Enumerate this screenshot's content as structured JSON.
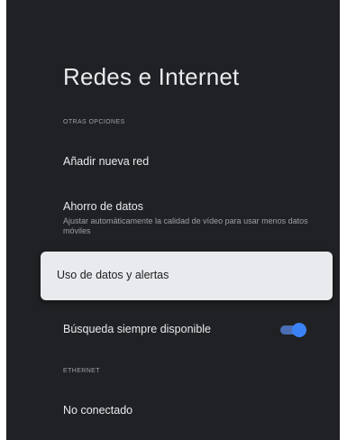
{
  "page": {
    "title": "Redes e Internet"
  },
  "sections": {
    "other_options": "OTRAS OPCIONES",
    "ethernet": "ETHERNET"
  },
  "items": {
    "add_network": {
      "label": "Añadir nueva red"
    },
    "data_saver": {
      "label": "Ahorro de datos",
      "description": "Ajustar automáticamente la calidad de vídeo para usar menos datos móviles"
    },
    "data_usage": {
      "label": "Uso de datos y alertas"
    },
    "always_scan": {
      "label": "Búsqueda siempre disponible",
      "toggle_on": true
    },
    "ethernet_status": {
      "label": "No conectado"
    }
  },
  "colors": {
    "background": "#202124",
    "focus": "#e8eaed",
    "accent": "#3b82f6"
  }
}
